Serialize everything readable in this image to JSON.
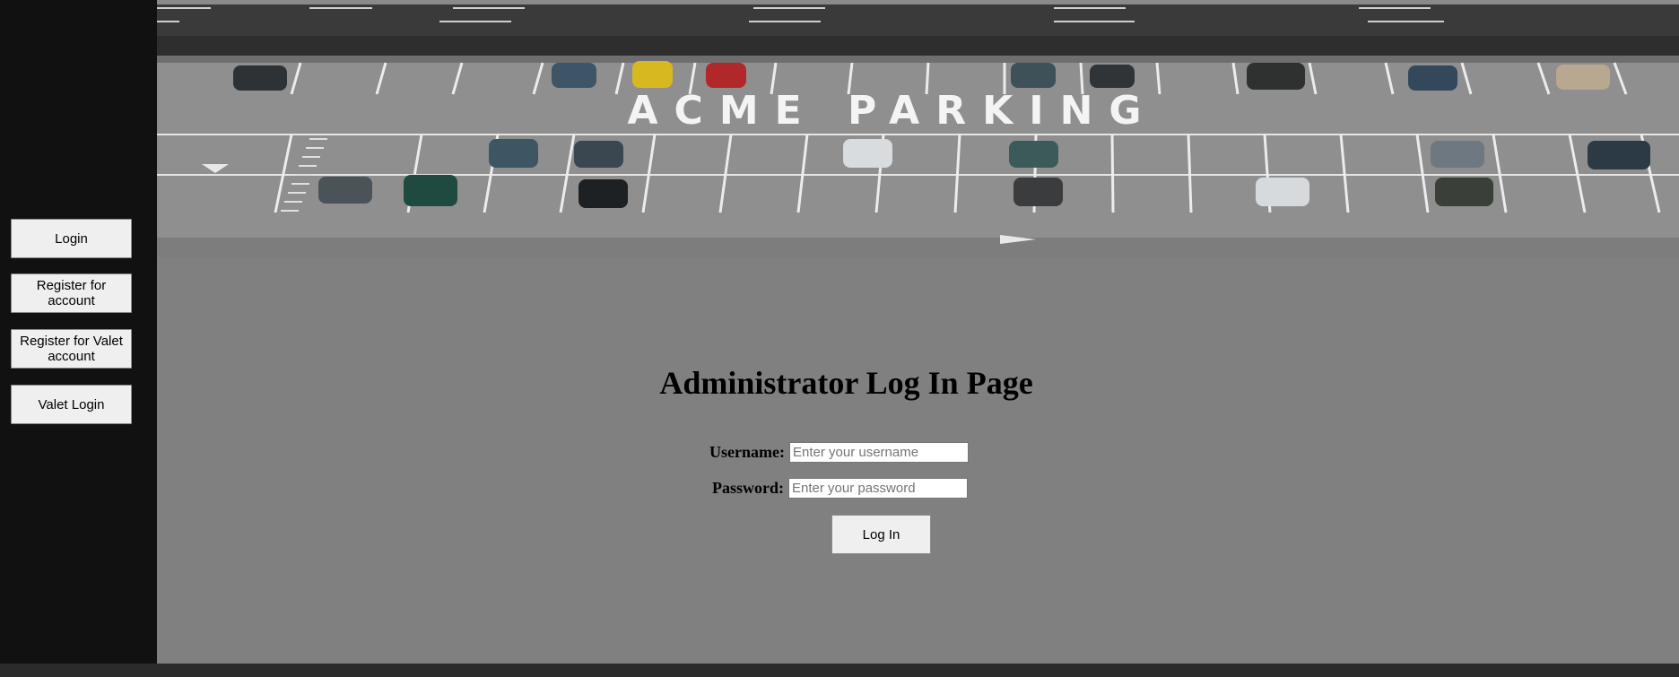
{
  "sidebar": {
    "buttons": [
      {
        "label": "Login"
      },
      {
        "label": "Register for account"
      },
      {
        "label": "Register for Valet account"
      },
      {
        "label": "Valet Login"
      }
    ]
  },
  "banner": {
    "painted_text": "ACME PARKING"
  },
  "form": {
    "title": "Administrator Log In Page",
    "username_label": "Username:",
    "username_placeholder": "Enter your username",
    "password_label": "Password:",
    "password_placeholder": "Enter your password",
    "submit_label": "Log In"
  },
  "colors": {
    "sidebar_bg": "#111111",
    "main_bg": "#808080",
    "button_bg": "#efefef"
  }
}
